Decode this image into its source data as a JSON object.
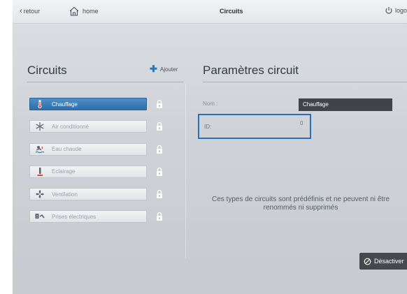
{
  "topbar": {
    "back_label": "retour",
    "home_label": "home",
    "title": "Circuits",
    "logout_label": "logout"
  },
  "left": {
    "title": "Circuits",
    "add_label": "Ajouter",
    "circuits": [
      {
        "label": "Chauffage",
        "icon": "thermometer-icon",
        "selected": true
      },
      {
        "label": "Air conditionné",
        "icon": "snowflake-icon",
        "selected": false
      },
      {
        "label": "Eau chaude",
        "icon": "water-heater-icon",
        "selected": false
      },
      {
        "label": "Eclairage",
        "icon": "lamp-icon",
        "selected": false
      },
      {
        "label": "Ventilation",
        "icon": "fan-icon",
        "selected": false
      },
      {
        "label": "Prises électriques",
        "icon": "power-plug-icon",
        "selected": false
      }
    ]
  },
  "right": {
    "title": "Paramètres circuit",
    "name_label": "Nom :",
    "name_value": "Chauffage",
    "id_label": "ID:",
    "id_value": "0",
    "info_text": "Ces types de circuits sont prédéfinis et ne peuvent ni être renommés ni supprimés",
    "deactivate_label": "Désactiver"
  },
  "colors": {
    "accent": "#2f6fa9",
    "highlight_border": "#2a6fb8",
    "dark_field": "#404347"
  }
}
